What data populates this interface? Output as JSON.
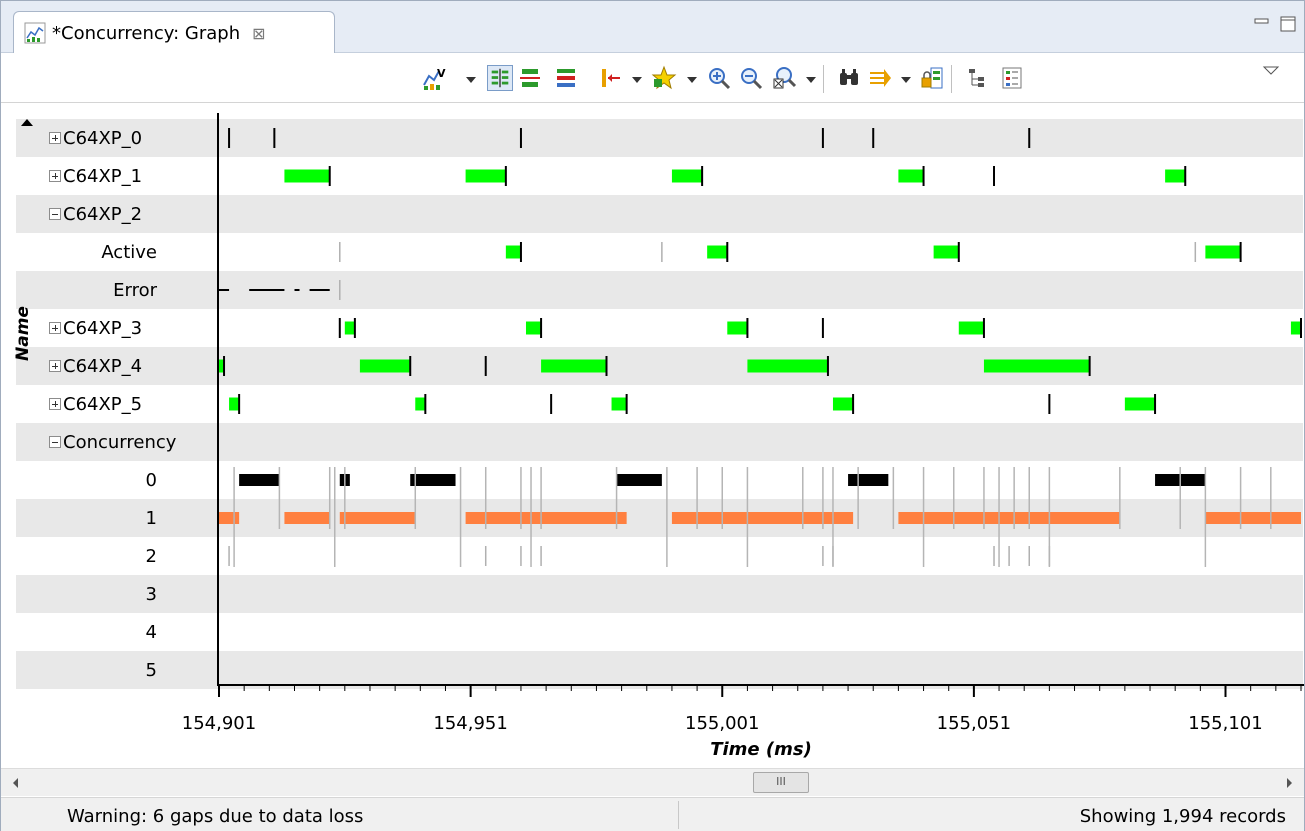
{
  "tab": {
    "title": "*Concurrency: Graph",
    "close_glyph": "⊠"
  },
  "toolbar": {
    "icons": [
      "chart-type-icon",
      "show-states-icon",
      "split-rows-icon",
      "merge-rows-icon",
      "timeline-icon",
      "bookmark-icon",
      "zoom-in-icon",
      "zoom-out-icon",
      "zoom-fit-icon",
      "find-icon",
      "sync-icon",
      "lock-icon",
      "tree-icon",
      "legend-icon",
      "view-menu-icon"
    ]
  },
  "rows": [
    {
      "label": "C64XP_0",
      "kind": "group",
      "expander": "plus"
    },
    {
      "label": "C64XP_1",
      "kind": "group",
      "expander": "plus"
    },
    {
      "label": "C64XP_2",
      "kind": "group",
      "expander": "minus"
    },
    {
      "label": "Active",
      "kind": "child"
    },
    {
      "label": "Error",
      "kind": "child"
    },
    {
      "label": "C64XP_3",
      "kind": "group",
      "expander": "plus"
    },
    {
      "label": "C64XP_4",
      "kind": "group",
      "expander": "plus"
    },
    {
      "label": "C64XP_5",
      "kind": "group",
      "expander": "plus"
    },
    {
      "label": "Concurrency",
      "kind": "group",
      "expander": "minus"
    },
    {
      "label": "0",
      "kind": "child"
    },
    {
      "label": "1",
      "kind": "child"
    },
    {
      "label": "2",
      "kind": "child"
    },
    {
      "label": "3",
      "kind": "child"
    },
    {
      "label": "4",
      "kind": "child"
    },
    {
      "label": "5",
      "kind": "child"
    }
  ],
  "axis": {
    "y_title": "Name",
    "x_title": "Time  (ms)",
    "x_ticks": [
      "154,901",
      "154,951",
      "155,001",
      "155,051",
      "155,101"
    ]
  },
  "chart_data": {
    "type": "timeline",
    "x_unit": "ms",
    "x_range": [
      154901,
      155116
    ],
    "colors": {
      "active": "#00ff00",
      "concurrency_0": "#000000",
      "concurrency_1": "#ff8040",
      "marker": "#000000"
    },
    "series": [
      {
        "row": "C64XP_0",
        "markers": [
          154903,
          154912,
          154961,
          155021,
          155031,
          155062
        ]
      },
      {
        "row": "C64XP_1",
        "intervals": [
          [
            154914,
            154923
          ],
          [
            154950,
            154958
          ],
          [
            154991,
            154997
          ],
          [
            155036,
            155041
          ],
          [
            155089,
            155093
          ]
        ],
        "markers": [
          155055
        ]
      },
      {
        "row": "Active",
        "intervals": [
          [
            154958,
            154961
          ],
          [
            154998,
            155002
          ],
          [
            155043,
            155048
          ],
          [
            155097,
            155104
          ]
        ],
        "markers": [
          154925,
          154989,
          155095
        ]
      },
      {
        "row": "Error",
        "dashes": [
          [
            154901,
            154903
          ],
          [
            154907,
            154914
          ],
          [
            154916,
            154917
          ],
          [
            154919,
            154923
          ]
        ],
        "markers": [
          154925
        ]
      },
      {
        "row": "C64XP_3",
        "intervals": [
          [
            154926,
            154928
          ],
          [
            154962,
            154965
          ],
          [
            155002,
            155006
          ],
          [
            155048,
            155053
          ],
          [
            155114,
            155116
          ]
        ],
        "markers": [
          154925,
          155021
        ]
      },
      {
        "row": "C64XP_4",
        "intervals": [
          [
            154901,
            154902
          ],
          [
            154929,
            154939
          ],
          [
            154965,
            154978
          ],
          [
            155006,
            155022
          ],
          [
            155053,
            155074
          ]
        ],
        "markers": [
          154954
        ]
      },
      {
        "row": "C64XP_5",
        "intervals": [
          [
            154903,
            154905
          ],
          [
            154940,
            154942
          ],
          [
            154979,
            154982
          ],
          [
            155023,
            155027
          ],
          [
            155081,
            155087
          ]
        ],
        "markers": [
          154967,
          155066
        ]
      },
      {
        "row": "0",
        "intervals": [
          [
            154905,
            154913
          ],
          [
            154925,
            154927
          ],
          [
            154939,
            154948
          ],
          [
            154980,
            154989
          ],
          [
            155026,
            155034
          ],
          [
            155087,
            155097
          ]
        ]
      },
      {
        "row": "1",
        "intervals": [
          [
            154901,
            154905
          ],
          [
            154914,
            154923
          ],
          [
            154925,
            154940
          ],
          [
            154950,
            154982
          ],
          [
            154991,
            155027
          ],
          [
            155036,
            155080
          ],
          [
            155097,
            155116
          ]
        ]
      },
      {
        "row": "2",
        "markers": [
          154903,
          154954,
          154961,
          154965,
          155021,
          155023,
          155055,
          155058,
          155062,
          155066
        ]
      }
    ]
  },
  "scrollbar": {
    "thumb_glyph": "III"
  },
  "status": {
    "warning": "Warning: 6 gaps due to data loss",
    "records": "Showing 1,994 records"
  }
}
